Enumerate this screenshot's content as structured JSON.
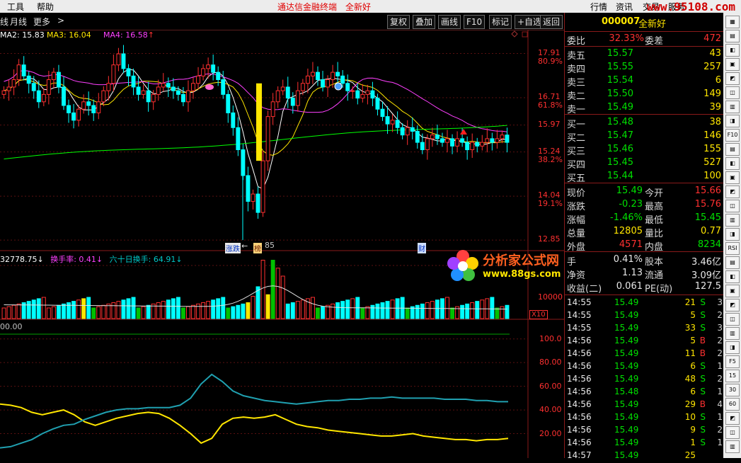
{
  "menu": {
    "tools": "工具",
    "help": "帮助",
    "title": "通达信金融终端",
    "title2": "全新好",
    "quote": "行情",
    "info": "资讯",
    "trade": "交易",
    "service": "服务",
    "logo": "www.95108.com"
  },
  "toolbar": {
    "period_cut": "线",
    "monthly": "月线",
    "more": "更多",
    "more_arrow": ">",
    "buttons": [
      "复权",
      "叠加",
      "画线",
      "F10",
      "标记",
      "+自选",
      "返回"
    ]
  },
  "ma_legend": {
    "ma2": "MA2: 15.83",
    "ma3": "MA3: 16.04",
    "ma4": "MA4: 16.58",
    "ma4_arrow": "↑"
  },
  "price_axis": [
    {
      "price": "17.91",
      "pct": "80.9%"
    },
    {
      "price": "16.71",
      "pct": "61.8%"
    },
    {
      "price": "15.97",
      "pct": ""
    },
    {
      "price": "15.24",
      "pct": "38.2%"
    },
    {
      "price": "14.04",
      "pct": "19.1%"
    },
    {
      "price": "12.85",
      "pct": ""
    }
  ],
  "chart_marks": {
    "low_label": "85",
    "low_arrow": "←",
    "tag1": "涨跌",
    "tag2": "榜",
    "tag3": "财"
  },
  "vol_legend": {
    "vol": "32778.75",
    "vol_arrow": "↓",
    "turnover": "换手率: 0.41",
    "turnover_arrow": "↓",
    "t60": "六十日换手: 64.91",
    "t60_arrow": "↓"
  },
  "vol_axis": {
    "v10000": "10000",
    "unit": "X10"
  },
  "ind_legend": {
    "val": "00.00"
  },
  "ind_axis": [
    "100.0",
    "80.00",
    "60.00",
    "40.00",
    "20.00"
  ],
  "colors": {
    "up": "#ff3030",
    "down": "#00ffff",
    "ma2": "#ffffff",
    "ma3": "#ffe600",
    "ma4": "#ff40ff",
    "ma5": "#00ff00",
    "vol_up": "#ffe600"
  },
  "stock": {
    "code": "000007",
    "name": "全新好"
  },
  "order": {
    "wb_label": "委比",
    "wb_val": "32.33%",
    "wc_label": "委差",
    "wc_val": "472"
  },
  "asks": [
    {
      "label": "卖五",
      "price": "15.57",
      "vol": "43"
    },
    {
      "label": "卖四",
      "price": "15.55",
      "vol": "257"
    },
    {
      "label": "卖三",
      "price": "15.54",
      "vol": "6"
    },
    {
      "label": "卖二",
      "price": "15.50",
      "vol": "149"
    },
    {
      "label": "卖一",
      "price": "15.49",
      "vol": "39"
    }
  ],
  "bids": [
    {
      "label": "买一",
      "price": "15.48",
      "vol": "38"
    },
    {
      "label": "买二",
      "price": "15.47",
      "vol": "146"
    },
    {
      "label": "买三",
      "price": "15.46",
      "vol": "155"
    },
    {
      "label": "买四",
      "price": "15.45",
      "vol": "527"
    },
    {
      "label": "买五",
      "price": "15.44",
      "vol": "100"
    }
  ],
  "stats": [
    {
      "k1": "现价",
      "v1": "15.49",
      "c1": "green",
      "k2": "今开",
      "v2": "15.66",
      "c2": "red"
    },
    {
      "k1": "涨跌",
      "v1": "-0.23",
      "c1": "green",
      "k2": "最高",
      "v2": "15.76",
      "c2": "red"
    },
    {
      "k1": "涨幅",
      "v1": "-1.46%",
      "c1": "green",
      "k2": "最低",
      "v2": "15.45",
      "c2": "green"
    },
    {
      "k1": "总量",
      "v1": "12805",
      "c1": "yellow",
      "k2": "量比",
      "v2": "0.77",
      "c2": "yellow"
    },
    {
      "k1": "外盘",
      "v1": "4571",
      "c1": "red",
      "k2": "内盘",
      "v2": "8234",
      "c2": "green"
    }
  ],
  "stats2": [
    {
      "k1": "手",
      "v1": "0.41%",
      "k2": "股本",
      "v2": "3.46亿"
    },
    {
      "k1": "净资",
      "v1": "1.13",
      "k2": "流通",
      "v2": "3.09亿"
    },
    {
      "k1": "收益(二)",
      "v1": "0.061",
      "k2": "PE(动)",
      "v2": "127.5"
    }
  ],
  "ticks": [
    {
      "t": "14:55",
      "p": "15.49",
      "v": "21",
      "d": "S",
      "n": "3"
    },
    {
      "t": "14:55",
      "p": "15.49",
      "v": "5",
      "d": "S",
      "n": "2"
    },
    {
      "t": "14:55",
      "p": "15.49",
      "v": "33",
      "d": "S",
      "n": "3"
    },
    {
      "t": "14:56",
      "p": "15.49",
      "v": "5",
      "d": "B",
      "n": "2"
    },
    {
      "t": "14:56",
      "p": "15.49",
      "v": "11",
      "d": "B",
      "n": "2"
    },
    {
      "t": "14:56",
      "p": "15.49",
      "v": "6",
      "d": "S",
      "n": "1"
    },
    {
      "t": "14:56",
      "p": "15.49",
      "v": "48",
      "d": "S",
      "n": "2"
    },
    {
      "t": "14:56",
      "p": "15.48",
      "v": "6",
      "d": "S",
      "n": "1"
    },
    {
      "t": "14:56",
      "p": "15.49",
      "v": "29",
      "d": "B",
      "n": "4"
    },
    {
      "t": "14:56",
      "p": "15.49",
      "v": "10",
      "d": "S",
      "n": "1"
    },
    {
      "t": "14:56",
      "p": "15.49",
      "v": "9",
      "d": "S",
      "n": "2"
    },
    {
      "t": "14:56",
      "p": "15.49",
      "v": "1",
      "d": "S",
      "n": "1"
    },
    {
      "t": "14:57",
      "p": "15.49",
      "v": "25",
      "d": "",
      "n": ""
    }
  ],
  "side_icons": [
    "F10",
    "RSI",
    "F5",
    "15",
    "30",
    "60"
  ],
  "watermark": {
    "cn": "分析家公式网",
    "url": "www.88gs.com"
  }
}
